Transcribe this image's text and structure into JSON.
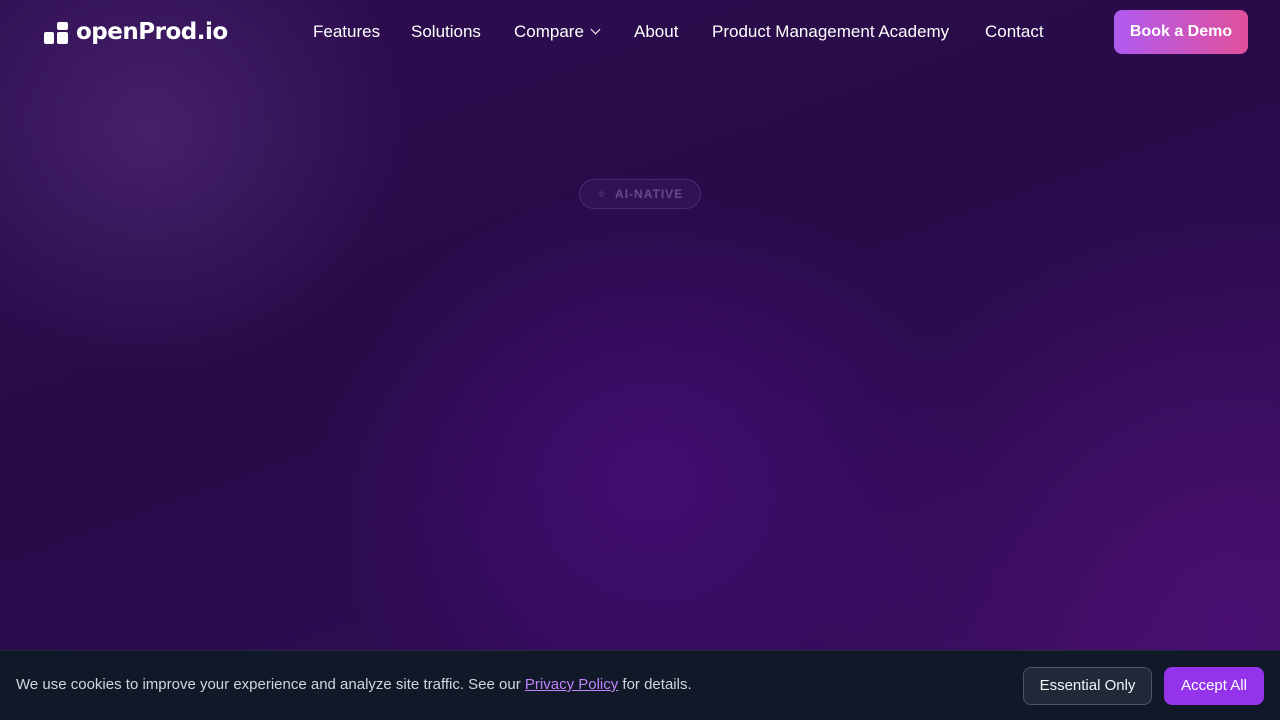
{
  "header": {
    "logo_text": "openProd.io",
    "nav": {
      "features": "Features",
      "solutions": "Solutions",
      "compare": "Compare",
      "about": "About",
      "academy": "Product Management Academy",
      "contact": "Contact"
    },
    "cta_label": "Book a Demo"
  },
  "hero": {
    "badge_label": "AI-NATIVE",
    "badge_icon": "sparkle-icon"
  },
  "cookie_banner": {
    "text_before": "We use cookies to improve your experience and analyze site traffic. See our ",
    "link_label": "Privacy Policy",
    "text_after": " for details.",
    "essential_label": "Essential Only",
    "accept_label": "Accept All"
  },
  "colors": {
    "background": "#2b0c4b",
    "cta_gradient_start": "#b05af0",
    "cta_gradient_end": "#e0509a",
    "accept_button": "#9333ea",
    "cookie_bar": "#111827",
    "link": "#c084fc"
  }
}
